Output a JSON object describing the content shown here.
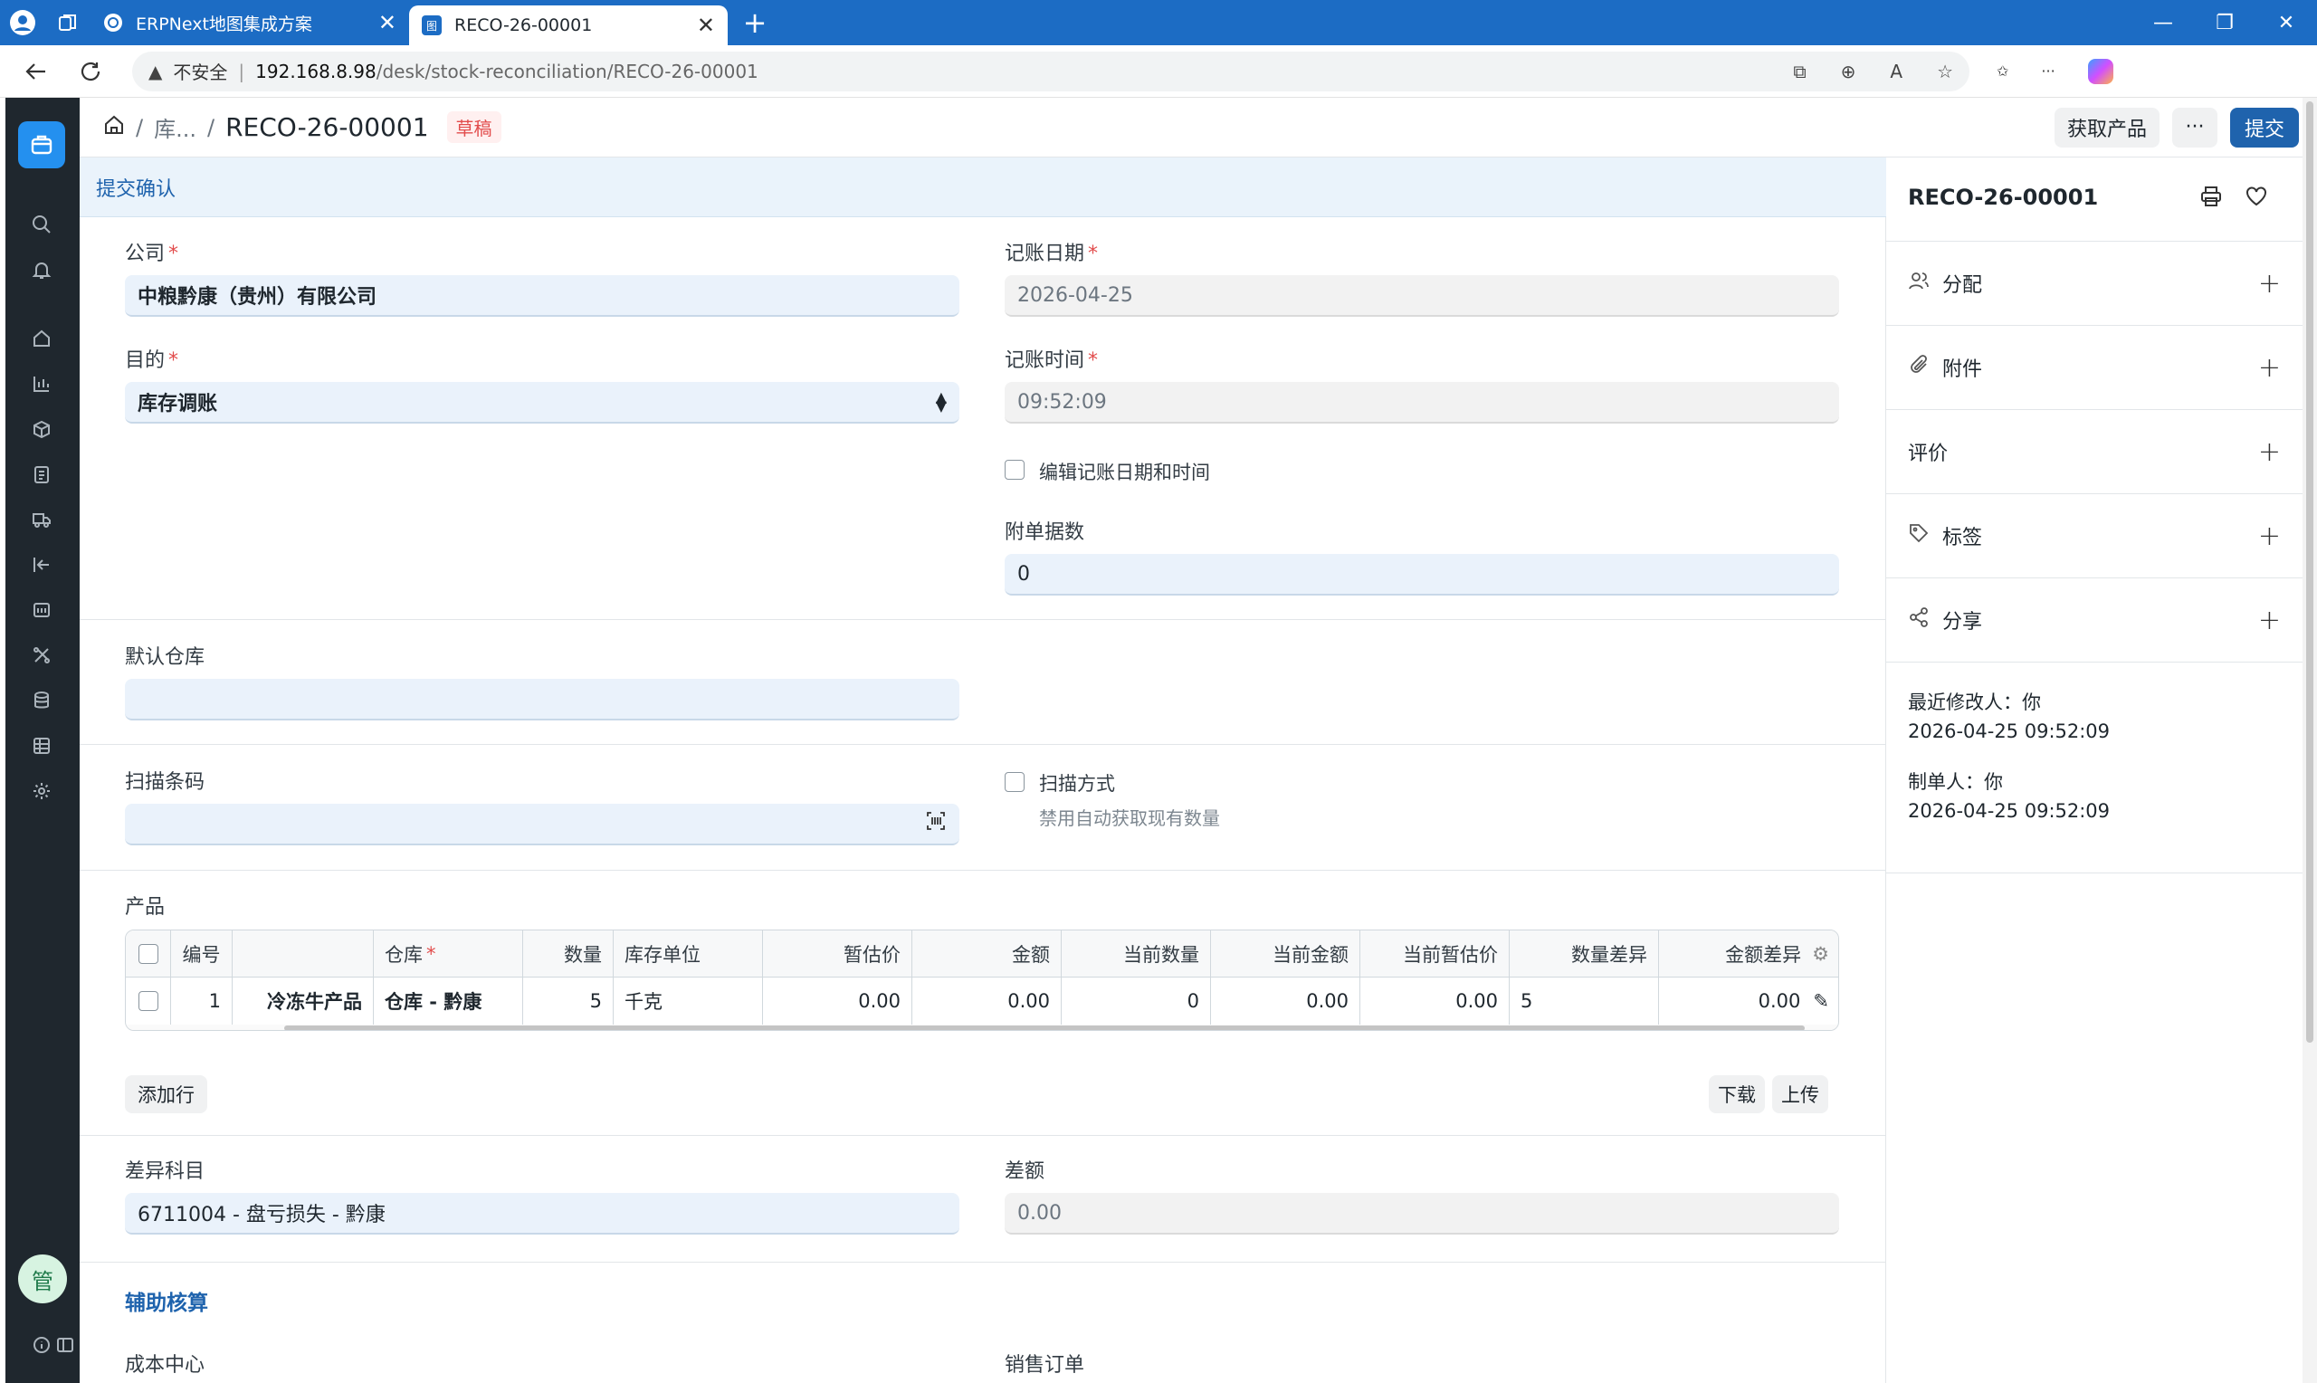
{
  "browser": {
    "tabs": [
      {
        "title": "ERPNext地图集成方案",
        "favicon": "gear-icon"
      },
      {
        "title": "RECO-26-00001",
        "favicon": "erp-icon",
        "favicon_text": "图"
      }
    ],
    "security_label": "不安全",
    "url_host": "192.168.8.98",
    "url_path": "/desk/stock-reconciliation/RECO-26-00001"
  },
  "header": {
    "breadcrumb_parent": "库...",
    "title": "RECO-26-00001",
    "status": "草稿",
    "get_items_label": "获取产品",
    "more_label": "···",
    "submit_label": "提交"
  },
  "alert": {
    "text": "提交确认"
  },
  "form": {
    "company": {
      "label": "公司",
      "value": "中粮黔康（贵州）有限公司"
    },
    "posting_date": {
      "label": "记账日期",
      "value": "2026-04-25"
    },
    "purpose": {
      "label": "目的",
      "value": "库存调账"
    },
    "posting_time": {
      "label": "记账时间",
      "value": "09:52:09"
    },
    "edit_posting": {
      "label": "编辑记账日期和时间",
      "checked": false
    },
    "attachments_count": {
      "label": "附单据数",
      "value": "0"
    },
    "default_warehouse": {
      "label": "默认仓库",
      "value": ""
    },
    "scan_barcode": {
      "label": "扫描条码",
      "value": ""
    },
    "scan_mode": {
      "label": "扫描方式",
      "description": "禁用自动获取现有数量",
      "checked": false
    },
    "items_label": "产品",
    "add_row_label": "添加行",
    "download_label": "下载",
    "upload_label": "上传",
    "difference_account": {
      "label": "差异科目",
      "value": "6711004 - 盘亏损失 - 黔康"
    },
    "difference_amount": {
      "label": "差额",
      "value": "0.00"
    },
    "accounting_dimensions_title": "辅助核算",
    "cost_center": {
      "label": "成本中心"
    },
    "sales_order": {
      "label": "销售订单"
    }
  },
  "table": {
    "headers": [
      "编号",
      "",
      "仓库",
      "数量",
      "库存单位",
      "暂估价",
      "金额",
      "当前数量",
      "当前金额",
      "当前暂估价",
      "数量差异",
      "金额差异"
    ],
    "rows": [
      [
        "1",
        "冷冻牛产品",
        "仓库 - 黔康",
        "5",
        "千克",
        "0.00",
        "0.00",
        "0",
        "0.00",
        "0.00",
        "5",
        "0.00"
      ]
    ]
  },
  "sidebar": {
    "title": "RECO-26-00001",
    "items": [
      {
        "label": "分配",
        "icon": "users-icon"
      },
      {
        "label": "附件",
        "icon": "paperclip-icon"
      },
      {
        "label": "评价",
        "icon": ""
      },
      {
        "label": "标签",
        "icon": "tag-icon"
      },
      {
        "label": "分享",
        "icon": "share-icon"
      }
    ],
    "modified_label": "最近修改人：你",
    "modified_time": "2026-04-25 09:52:09",
    "created_label": "制单人：你",
    "created_time": "2026-04-25 09:52:09"
  },
  "user": {
    "avatar_text": "管"
  },
  "colors": {
    "primary": "#1f63ad",
    "tabbar": "#1c6cc4",
    "sidebar": "#1f272e",
    "draft": "#e24c4c"
  }
}
